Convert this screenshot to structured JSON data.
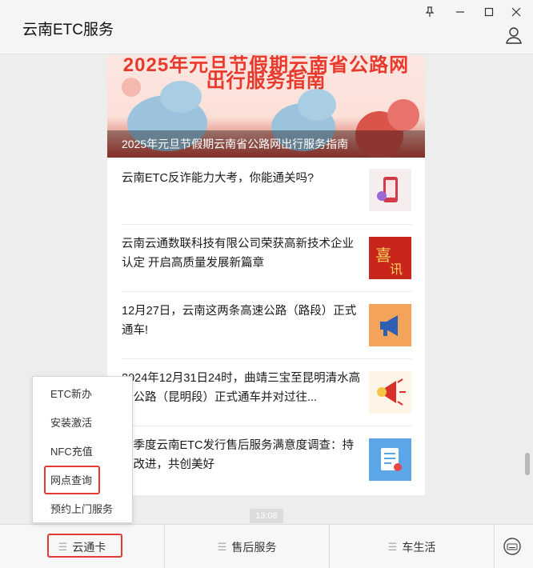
{
  "window": {
    "title": "云南ETC服务",
    "controls": [
      "pin-icon",
      "minimize-icon",
      "maximize-icon",
      "close-icon"
    ]
  },
  "banner": {
    "big_text_top": "2025年元旦节假期云南省公路网",
    "big_text_bottom": "出行服务指南",
    "caption": "2025年元旦节假期云南省公路网出行服务指南"
  },
  "articles": [
    {
      "title": "云南ETC反诈能力大考，你能通关吗?",
      "thumb_icon": "phone-fraud-icon"
    },
    {
      "title": "云南云通数联科技有限公司荣获高新技术企业认定 开启高质量发展新篇章",
      "thumb_icon": "celebration-icon"
    },
    {
      "title": "12月27日，云南这两条高速公路（路段）正式通车!",
      "thumb_icon": "megaphone-icon"
    },
    {
      "title": "2024年12月31日24时，曲靖三宝至昆明清水高速公路（昆明段）正式通车并对过往...",
      "thumb_icon": "megaphone-red-icon"
    },
    {
      "title": "四季度云南ETC发行售后服务满意度调查：持续改进，共创美好",
      "thumb_icon": "survey-icon"
    }
  ],
  "timestamp": "13:08",
  "popup_menu": {
    "items": [
      "ETC新办",
      "安装激活",
      "NFC充值",
      "网点查询",
      "预约上门服务"
    ],
    "highlighted_index": 3
  },
  "bottom_tabs": [
    {
      "label": "云通卡",
      "active_highlight": true
    },
    {
      "label": "售后服务",
      "active_highlight": false
    },
    {
      "label": "车生活",
      "active_highlight": false
    }
  ],
  "colors": {
    "highlight": "#e53935",
    "banner_text": "#e83a2c"
  }
}
